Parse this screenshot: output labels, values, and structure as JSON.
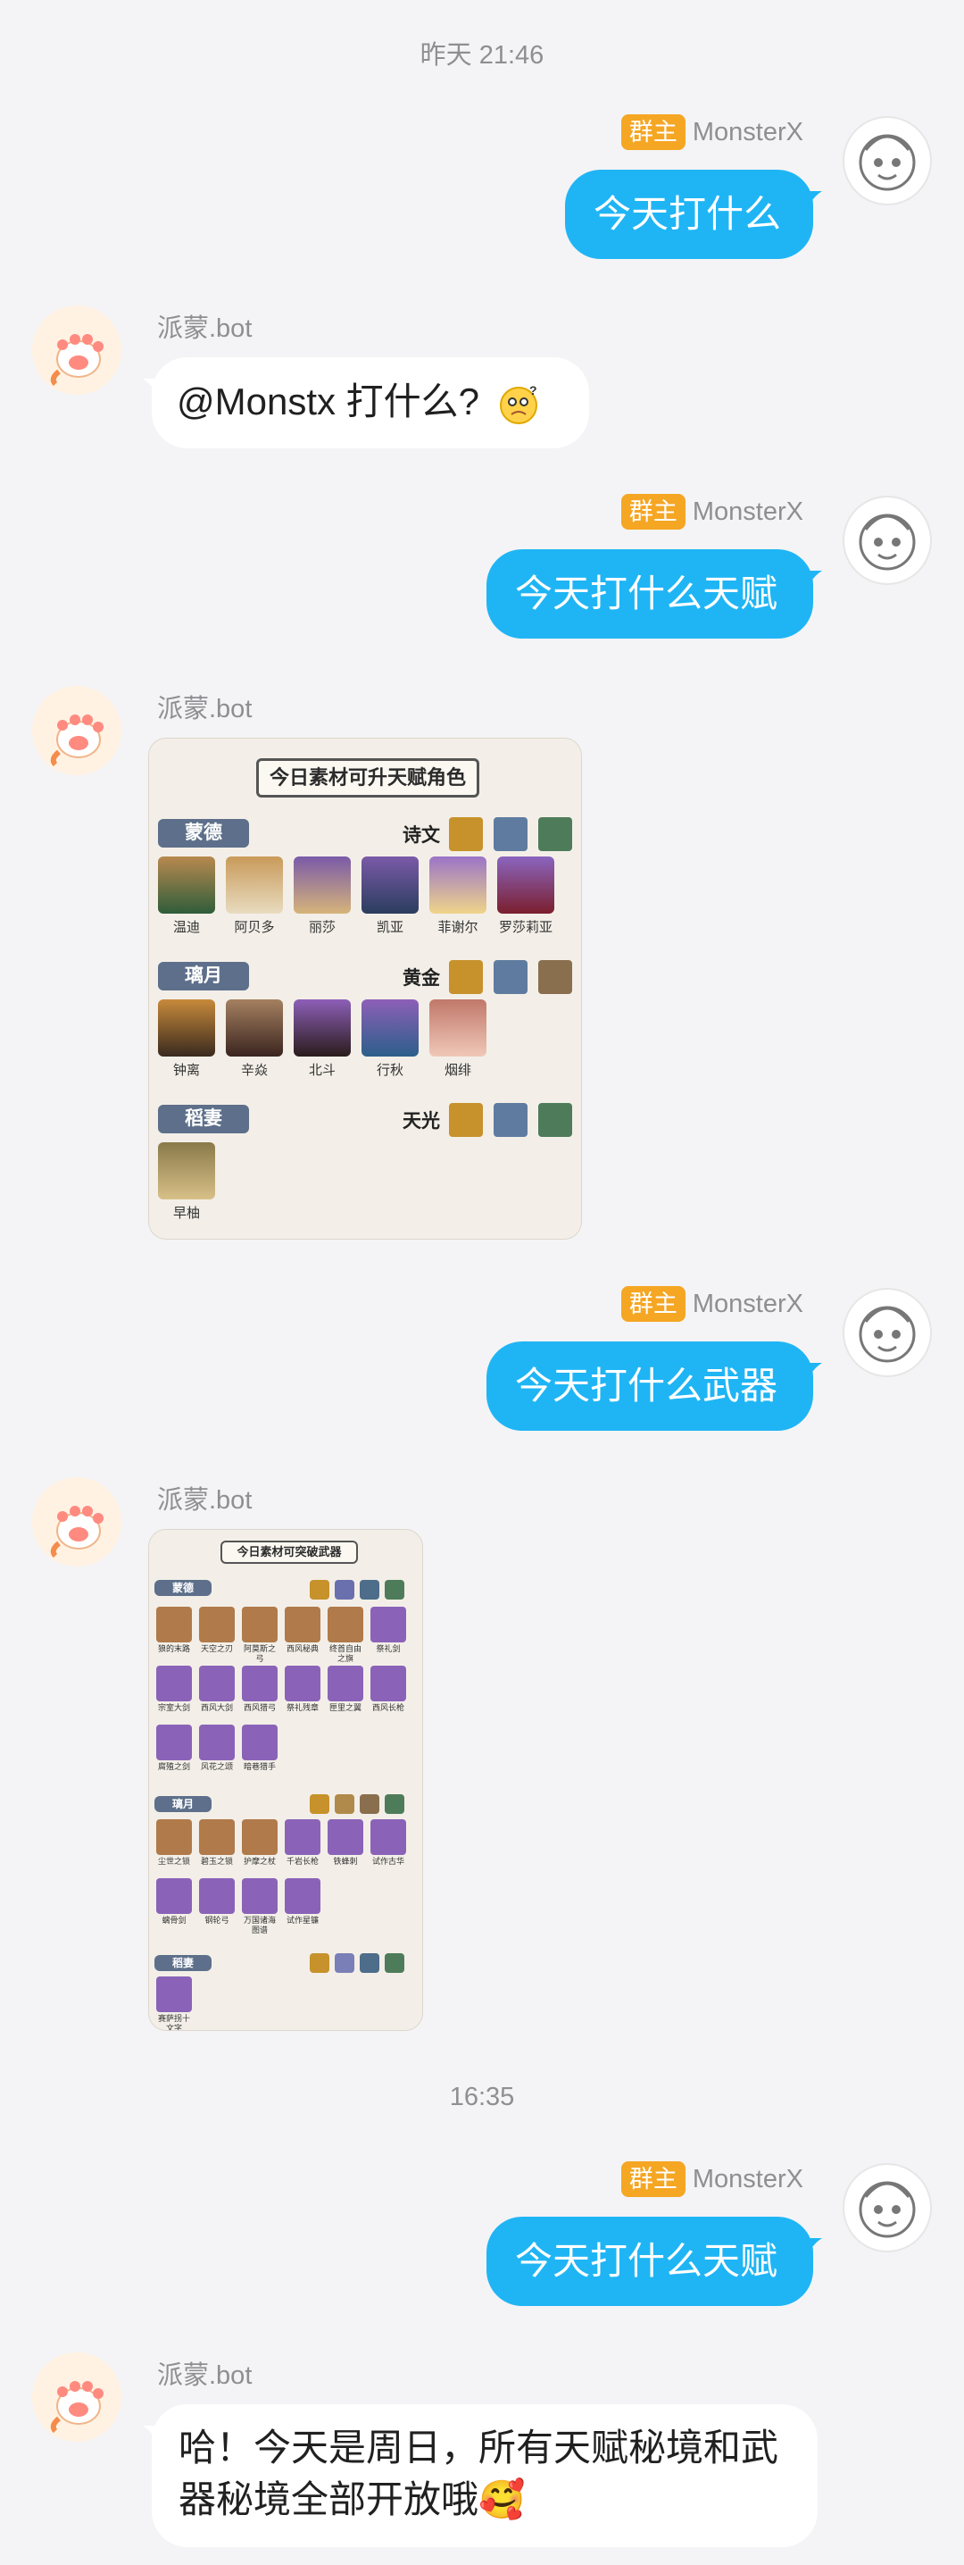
{
  "messages": {
    "ts1": "昨天 21:46",
    "ts2": "16:35",
    "role_badge": "群主",
    "user_name": "MonsterX",
    "bot_name": "派蒙.bot",
    "m1": "今天打什么",
    "m2": "@Monstx  打什么?",
    "m3": "今天打什么天赋",
    "m5": "今天打什么武器",
    "m7": "今天打什么天赋",
    "m8": "哈！今天是周日，所有天赋秘境和武器秘境全部开放哦🥰"
  },
  "talent_card": {
    "title": "今日素材可升天赋角色",
    "groups": [
      {
        "region": "蒙德",
        "book": "诗文",
        "characters": [
          "温迪",
          "阿贝多",
          "丽莎",
          "凯亚",
          "菲谢尔",
          "罗莎莉亚"
        ]
      },
      {
        "region": "璃月",
        "book": "黄金",
        "characters": [
          "钟离",
          "辛焱",
          "北斗",
          "行秋",
          "烟绯"
        ]
      },
      {
        "region": "稻妻",
        "book": "天光",
        "characters": [
          "早柚"
        ]
      }
    ]
  },
  "weapon_card": {
    "title": "今日素材可突破武器",
    "groups": [
      {
        "region": "蒙德",
        "weapons": [
          "狼的末路",
          "天空之刃",
          "阿莫斯之弓",
          "西风秘典",
          "终首自由之旗",
          "祭礼剑",
          "宗室大剑",
          "西风大剑",
          "西风猎弓",
          "祭礼残章",
          "匣里之翼",
          "西风长枪",
          "腐殖之剑",
          "风花之颂",
          "暗巷猎手"
        ]
      },
      {
        "region": "璃月",
        "weapons": [
          "尘世之锁",
          "碧玉之锁",
          "护摩之杖",
          "千岩长枪",
          "铁蜂刺",
          "试作古华",
          "螭骨剑",
          "钢轮弓",
          "万国诸海图谱",
          "试作星镰"
        ]
      },
      {
        "region": "稻妻",
        "weapons": [
          "赛萨拐十文字"
        ]
      }
    ]
  },
  "colors": {
    "bubble_blue": "#1fb5f5",
    "badge_orange": "#f5a623",
    "background": "#f4f4f6"
  }
}
